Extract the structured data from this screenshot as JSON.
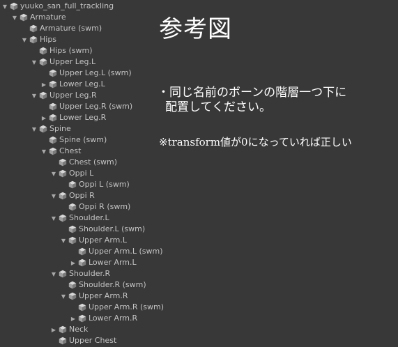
{
  "hierarchy": {
    "rows": [
      {
        "label": "yuuko_san_full_trackling",
        "depth": 0,
        "arrow": "expanded"
      },
      {
        "label": "Armature",
        "depth": 1,
        "arrow": "expanded"
      },
      {
        "label": "Armature (swm)",
        "depth": 2,
        "arrow": "none"
      },
      {
        "label": "Hips",
        "depth": 2,
        "arrow": "expanded"
      },
      {
        "label": "Hips (swm)",
        "depth": 3,
        "arrow": "none"
      },
      {
        "label": "Upper Leg.L",
        "depth": 3,
        "arrow": "expanded"
      },
      {
        "label": "Upper Leg.L (swm)",
        "depth": 4,
        "arrow": "none"
      },
      {
        "label": "Lower Leg.L",
        "depth": 4,
        "arrow": "collapsed"
      },
      {
        "label": "Upper Leg.R",
        "depth": 3,
        "arrow": "expanded"
      },
      {
        "label": "Upper Leg.R (swm)",
        "depth": 4,
        "arrow": "none"
      },
      {
        "label": "Lower Leg.R",
        "depth": 4,
        "arrow": "collapsed"
      },
      {
        "label": "Spine",
        "depth": 3,
        "arrow": "expanded"
      },
      {
        "label": "Spine (swm)",
        "depth": 4,
        "arrow": "none"
      },
      {
        "label": "Chest",
        "depth": 4,
        "arrow": "expanded"
      },
      {
        "label": "Chest (swm)",
        "depth": 5,
        "arrow": "none"
      },
      {
        "label": "Oppi L",
        "depth": 5,
        "arrow": "expanded"
      },
      {
        "label": "Oppi L (swm)",
        "depth": 6,
        "arrow": "none"
      },
      {
        "label": "Oppi R",
        "depth": 5,
        "arrow": "expanded"
      },
      {
        "label": "Oppi R (swm)",
        "depth": 6,
        "arrow": "none"
      },
      {
        "label": "Shoulder.L",
        "depth": 5,
        "arrow": "expanded"
      },
      {
        "label": "Shoulder.L (swm)",
        "depth": 6,
        "arrow": "none"
      },
      {
        "label": "Upper Arm.L",
        "depth": 6,
        "arrow": "expanded"
      },
      {
        "label": "Upper Arm.L (swm)",
        "depth": 7,
        "arrow": "none"
      },
      {
        "label": "Lower Arm.L",
        "depth": 7,
        "arrow": "collapsed"
      },
      {
        "label": "Shoulder.R",
        "depth": 5,
        "arrow": "expanded"
      },
      {
        "label": "Shoulder.R (swm)",
        "depth": 6,
        "arrow": "none"
      },
      {
        "label": "Upper Arm.R",
        "depth": 6,
        "arrow": "expanded"
      },
      {
        "label": "Upper Arm.R (swm)",
        "depth": 7,
        "arrow": "none"
      },
      {
        "label": "Lower Arm.R",
        "depth": 7,
        "arrow": "collapsed"
      },
      {
        "label": "Neck",
        "depth": 5,
        "arrow": "collapsed"
      },
      {
        "label": "Upper Chest",
        "depth": 5,
        "arrow": "none"
      }
    ]
  },
  "annotation": {
    "title": "参考図",
    "line1": "・同じ名前のボーンの階層一つ下に",
    "line2": "配置してください。",
    "line3": "※transform値が0になっていれば正しい"
  },
  "icons": {
    "expanded_arrow": "triangle-down-icon",
    "collapsed_arrow": "triangle-right-icon",
    "gameobject": "cube-icon"
  },
  "colors": {
    "background": "#383838",
    "label_text": "#c4c4c4",
    "annotation_text": "#ffffff",
    "cube_top": "#d8d8d8",
    "cube_left": "#a0a0a0",
    "cube_right": "#7a7a7a"
  }
}
